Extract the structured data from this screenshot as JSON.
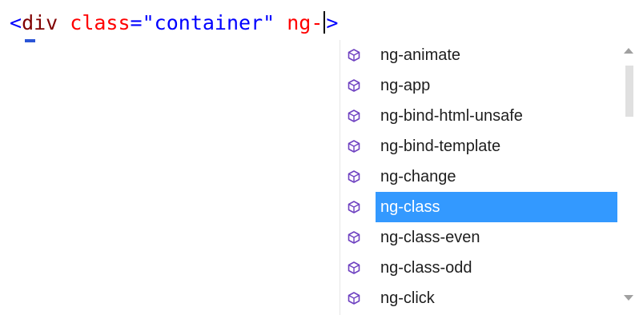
{
  "editor": {
    "tokens": {
      "open_bracket": "<",
      "tag": "div",
      "attr": "class",
      "eq": "=",
      "value": "\"container\"",
      "typed": "ng-",
      "close_bracket": ">"
    }
  },
  "completion": {
    "items": [
      {
        "label": "ng-animate",
        "icon": "directive-icon"
      },
      {
        "label": "ng-app",
        "icon": "directive-icon"
      },
      {
        "label": "ng-bind-html-unsafe",
        "icon": "directive-icon"
      },
      {
        "label": "ng-bind-template",
        "icon": "directive-icon"
      },
      {
        "label": "ng-change",
        "icon": "directive-icon"
      },
      {
        "label": "ng-class",
        "icon": "directive-icon",
        "selected": true
      },
      {
        "label": "ng-class-even",
        "icon": "directive-icon"
      },
      {
        "label": "ng-class-odd",
        "icon": "directive-icon"
      },
      {
        "label": "ng-click",
        "icon": "directive-icon"
      }
    ],
    "selected_color": "#3399ff",
    "icon_color": "#6f42c1"
  }
}
